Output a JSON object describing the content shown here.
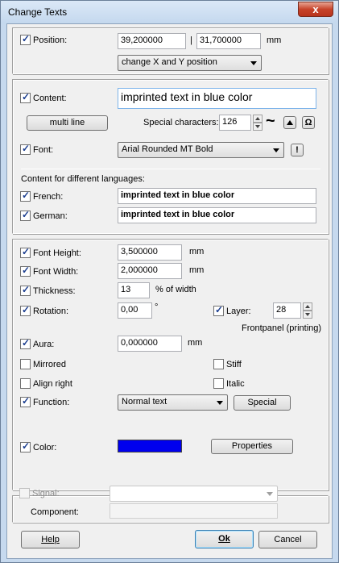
{
  "window": {
    "title": "Change Texts",
    "close_glyph": "x"
  },
  "position": {
    "label": "Position:",
    "x": "39,200000",
    "separator": "|",
    "y": "31,700000",
    "unit": "mm",
    "mode": "change X and Y position"
  },
  "content": {
    "label": "Content:",
    "value": "imprinted text in blue color",
    "multiline_label": "multi line",
    "special_chars_label": "Special characters:",
    "special_chars_value": "126",
    "tilde": "~",
    "omega": "Ω",
    "font_label": "Font:",
    "font_value": "Arial Rounded MT Bold",
    "font_warn": "!",
    "lang_heading": "Content for different languages:",
    "french_label": "French:",
    "french_value": "imprinted text in blue color",
    "german_label": "German:",
    "german_value": "imprinted text in blue color"
  },
  "props": {
    "font_height_label": "Font Height:",
    "font_height": "3,500000",
    "font_height_unit": "mm",
    "font_width_label": "Font Width:",
    "font_width": "2,000000",
    "font_width_unit": "mm",
    "thickness_label": "Thickness:",
    "thickness": "13",
    "thickness_unit": "% of width",
    "rotation_label": "Rotation:",
    "rotation": "0,00",
    "rotation_unit": "°",
    "layer_label": "Layer:",
    "layer": "28",
    "layer_desc": "Frontpanel (printing)",
    "aura_label": "Aura:",
    "aura": "0,000000",
    "aura_unit": "mm",
    "mirrored_label": "Mirrored",
    "stiff_label": "Stiff",
    "align_right_label": "Align right",
    "italic_label": "Italic",
    "function_label": "Function:",
    "function_value": "Normal text",
    "special_button": "Special",
    "color_label": "Color:",
    "color_value": "#0000ee",
    "properties_button": "Properties"
  },
  "signal": {
    "label": "Signal:",
    "value": "",
    "component_label": "Component:",
    "component_value": ""
  },
  "footer": {
    "help": "Help",
    "ok": "Ok",
    "cancel": "Cancel"
  }
}
